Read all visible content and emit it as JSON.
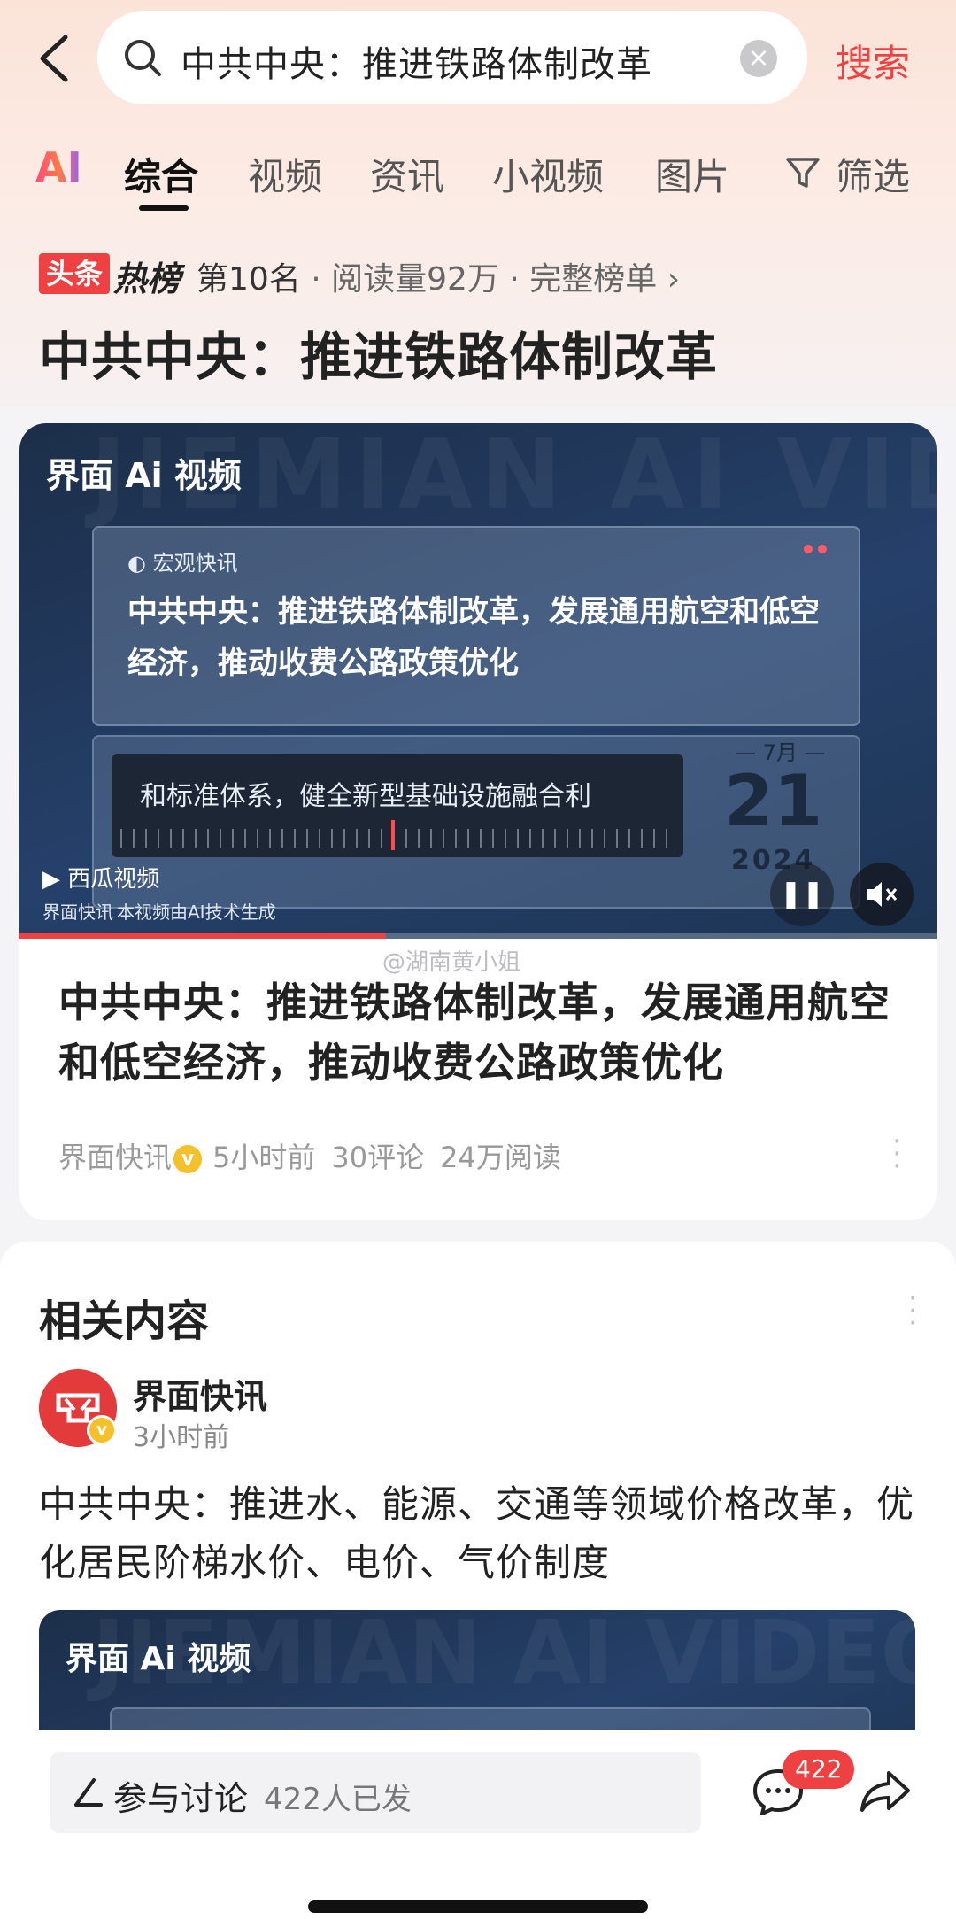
{
  "search": {
    "query": "中共中央：推进铁路体制改革",
    "submit_label": "搜索"
  },
  "tabs": {
    "ai_label": "AI",
    "items": [
      "综合",
      "视频",
      "资讯",
      "小视频",
      "图片",
      "筛选"
    ],
    "active": "综合"
  },
  "hotlist": {
    "badge": "头条",
    "word": "热榜",
    "rank": "第10名",
    "reads": "· 阅读量92万",
    "full_list": "· 完整榜单 ›"
  },
  "page_title": "中共中央：推进铁路体制改革",
  "video": {
    "watermark": "JIEMIAN AI VIDEO",
    "logo": "界面 Ai 视频",
    "tag": "宏观快讯",
    "headline": "中共中央：推进铁路体制改革，发展通用航空和低空经济，推动收费公路政策优化",
    "subtitle": "和标准体系，健全新型基础设施融合利",
    "date_month": "— 7月 —",
    "date_day": "21",
    "date_year": "2024",
    "platform": "西瓜视频",
    "source": "界面快讯",
    "ai_note": "本视频由AI技术生成",
    "progress": 0.4,
    "accent_color": "#f04142"
  },
  "watermark_text": "@湖南黄小姐",
  "article": {
    "title": "中共中央：推进铁路体制改革，发展通用航空和低空经济，推动收费公路政策优化",
    "source": "界面快讯",
    "time": "5小时前",
    "comments": "30评论",
    "reads": "24万阅读"
  },
  "related": {
    "title": "相关内容",
    "author": "界面快讯",
    "time": "3小时前",
    "text": "中共中央：推进水、能源、交通等领域价格改革，优化居民阶梯水价、电价、气价制度",
    "video_logo": "界面 Ai 视频",
    "video_watermark": "JIEMIAN AI VIDEO"
  },
  "bottom": {
    "discuss_label": "参与讨论",
    "discuss_count": "422人已发",
    "comment_badge": "422"
  },
  "icons": [
    "back-icon",
    "search-icon",
    "clear-icon",
    "filter-icon",
    "verified-icon",
    "more-icon",
    "pause-icon",
    "mute-icon",
    "pen-icon",
    "comment-icon",
    "share-icon"
  ]
}
